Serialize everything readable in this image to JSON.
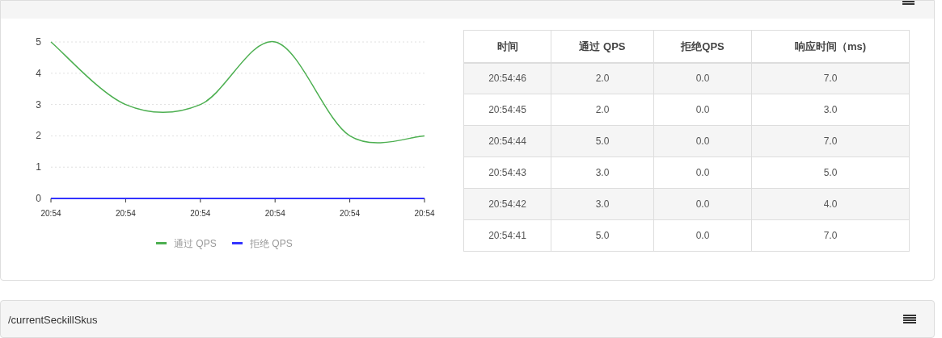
{
  "top_panel": {
    "chart_data": {
      "type": "line",
      "grid": true,
      "legend": true,
      "categories": [
        "20:54",
        "20:54",
        "20:54",
        "20:54",
        "20:54",
        "20:54"
      ],
      "ylim": [
        0,
        5
      ],
      "yticks": [
        0,
        1,
        2,
        3,
        4,
        5
      ],
      "series": [
        {
          "name": "通过 QPS",
          "color": "#4caf50",
          "values": [
            5,
            3,
            3,
            5,
            2,
            2
          ]
        },
        {
          "name": "拒绝 QPS",
          "color": "#3333ff",
          "values": [
            0,
            0,
            0,
            0,
            0,
            0
          ]
        }
      ]
    },
    "table": {
      "columns": [
        "时间",
        "通过 QPS",
        "拒绝QPS",
        "响应时间（ms)"
      ],
      "rows": [
        [
          "20:54:46",
          "2.0",
          "0.0",
          "7.0"
        ],
        [
          "20:54:45",
          "2.0",
          "0.0",
          "3.0"
        ],
        [
          "20:54:44",
          "5.0",
          "0.0",
          "7.0"
        ],
        [
          "20:54:43",
          "3.0",
          "0.0",
          "5.0"
        ],
        [
          "20:54:42",
          "3.0",
          "0.0",
          "4.0"
        ],
        [
          "20:54:41",
          "5.0",
          "0.0",
          "7.0"
        ]
      ]
    }
  },
  "bottom_panel": {
    "title": "/currentSeckillSkus"
  }
}
